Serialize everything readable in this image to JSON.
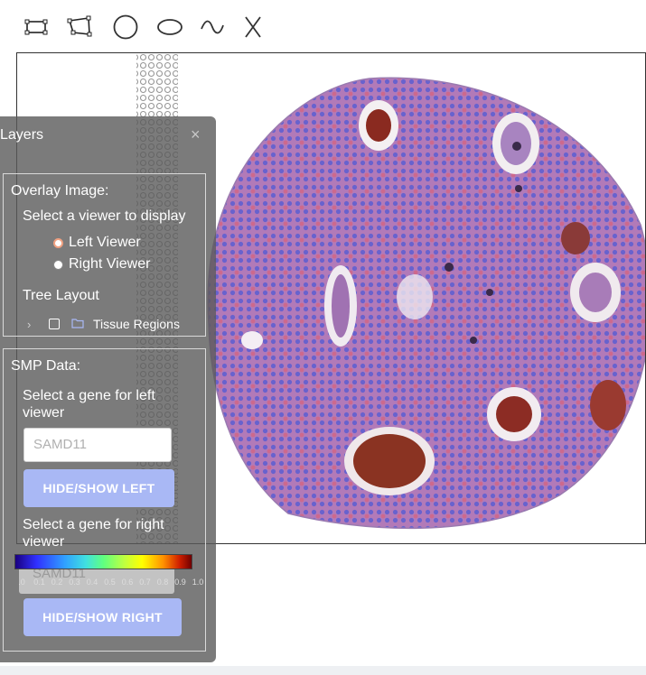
{
  "toolbar": {
    "tools": [
      {
        "name": "rectangle-select-icon"
      },
      {
        "name": "polygon-select-icon"
      },
      {
        "name": "circle-select-icon"
      },
      {
        "name": "ellipse-select-icon"
      },
      {
        "name": "freehand-select-icon"
      },
      {
        "name": "clear-selection-icon"
      }
    ]
  },
  "layers_panel": {
    "title": "Layers",
    "close_symbol": "×",
    "overlay": {
      "heading": "Overlay Image:",
      "prompt": "Select a viewer to display",
      "options": [
        "Left Viewer",
        "Right Viewer"
      ],
      "selected": "Left Viewer"
    },
    "tree": {
      "heading": "Tree Layout",
      "node_label": "Tissue Regions"
    },
    "smp": {
      "heading": "SMP Data:",
      "left_prompt_line1": "Select a gene for left",
      "left_prompt_line2": "viewer",
      "left_gene_value": "SAMD11",
      "left_button": "HIDE/SHOW LEFT",
      "right_prompt_line1": "Select a gene for right",
      "right_prompt_line2": "viewer",
      "right_gene_value": "SAMD11",
      "right_button": "HIDE/SHOW RIGHT"
    },
    "colorbar_ticks": [
      ".0",
      "0.1",
      "0.2",
      "0.3",
      "0.4",
      "0.5",
      "0.6",
      "0.7",
      "0.8",
      "0.9",
      "1.0"
    ]
  },
  "colors": {
    "tissue": "#8a6bc0",
    "spot": "#5a60d8",
    "button": "#a9b8f5"
  }
}
